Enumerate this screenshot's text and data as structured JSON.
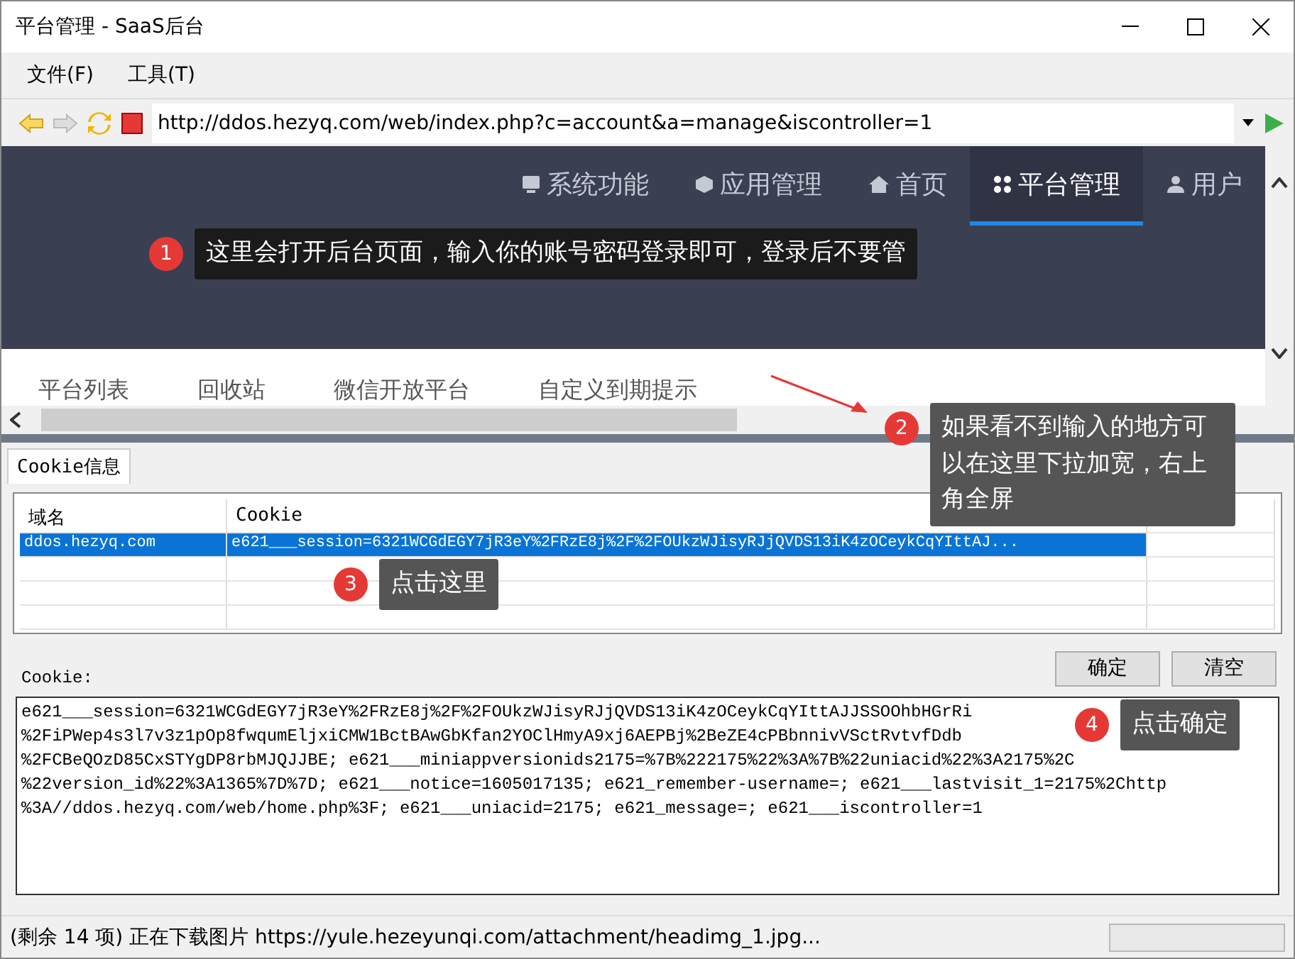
{
  "window": {
    "title": "平台管理 - SaaS后台"
  },
  "menu": [
    "文件(F)",
    "工具(T)"
  ],
  "address": {
    "value": "http://ddos.hezyq.com/web/index.php?c=account&a=manage&iscontroller=1"
  },
  "site_nav": [
    {
      "label": "系统功能",
      "selected": false
    },
    {
      "label": "应用管理",
      "selected": false
    },
    {
      "label": "首页",
      "selected": false
    },
    {
      "label": "平台管理",
      "selected": true
    },
    {
      "label": "用户",
      "selected": false
    }
  ],
  "sub_tabs": [
    "平台列表",
    "回收站",
    "微信开放平台",
    "自定义到期提示"
  ],
  "panel": {
    "tab": "Cookie信息",
    "columns": [
      "域名",
      "Cookie"
    ],
    "rows": [
      {
        "domain": "ddos.hezyq.com",
        "cookie": "e621___session=6321WCGdEGY7jR3eY%2FRzE8j%2F%2FOUkzWJisyRJjQVDS13iK4zOCeykCqYIttAJ...",
        "selected": true
      }
    ],
    "cookie_label": "Cookie:",
    "buttons": [
      "确定",
      "清空"
    ],
    "cookie_lines": [
      "e621___session=6321WCGdEGY7jR3eY%2FRzE8j%2F%2FOUkzWJisyRJjQVDS13iK4zOCeykCqYIttAJJSSOOhbHGrRi",
      "%2FiPWep4s3l7v3z1pOp8fwqumEljxiCMW1BctBAwGbKfan2YOClHmyA9xj6AEPBj%2BeZE4cPBbnnivVSctRvtvfDdb",
      "%2FCBeQOzD85CxSTYgDP8rbMJQJJBE; e621___miniappversionids2175=%7B%222175%22%3A%7B%22uniacid%22%3A2175%2C",
      "%22version_id%22%3A1365%7D%7D; e621___notice=1605017135; e621_remember-username=; e621___lastvisit_1=2175%2Chttp",
      "%3A//ddos.hezyq.com/web/home.php%3F; e621___uniacid=2175; e621_message=; e621___iscontroller=1"
    ]
  },
  "status_bar": {
    "text": "(剩余 14 项) 正在下载图片 https://yule.hezeyunqi.com/attachment/headimg_1.jpg..."
  },
  "callouts": [
    {
      "number": "1",
      "text": "这里会打开后台页面，输入你的账号密码登录即可，登录后不要管"
    },
    {
      "number": "2",
      "text": "如果看不到输入的地方可以在这里下拉加宽，右上角全屏"
    },
    {
      "number": "3",
      "text": "点击这里"
    },
    {
      "number": "4",
      "text": "点击确定"
    }
  ]
}
